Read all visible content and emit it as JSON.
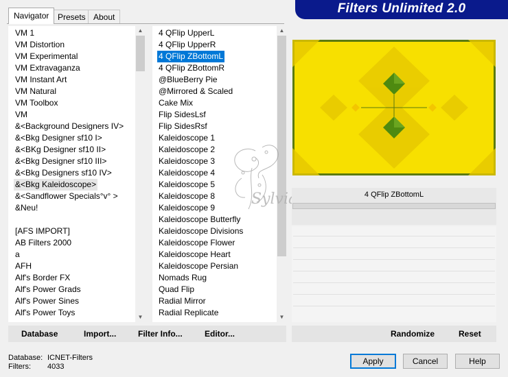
{
  "tabs": [
    {
      "label": "Navigator",
      "active": true
    },
    {
      "label": "Presets",
      "active": false
    },
    {
      "label": "About",
      "active": false
    }
  ],
  "banner": {
    "title": "Filters Unlimited 2.0"
  },
  "categories": {
    "items": [
      "VM 1",
      "VM Distortion",
      "VM Experimental",
      "VM Extravaganza",
      "VM Instant Art",
      "VM Natural",
      "VM Toolbox",
      "VM",
      "&<Background Designers IV>",
      "&<Bkg Designer sf10 I>",
      "&<BKg Designer sf10 II>",
      "&<Bkg Designer sf10 III>",
      "&<Bkg Designers sf10 IV>",
      "&<Bkg Kaleidoscope>",
      "&<Sandflower Specials°v° >",
      "&Neu!",
      "",
      "[AFS IMPORT]",
      "AB Filters 2000",
      "a",
      "AFH",
      "Alf's Border FX",
      "Alf's Power Grads",
      "Alf's Power Sines",
      "Alf's Power Toys"
    ],
    "highlighted_index": 13
  },
  "filters": {
    "items": [
      "4 QFlip UpperL",
      "4 QFlip UpperR",
      "4 QFlip ZBottomL",
      "4 QFlip ZBottomR",
      "@BlueBerry Pie",
      "@Mirrored & Scaled",
      "Cake Mix",
      "Flip SidesLsf",
      "Flip SidesRsf",
      "Kaleidoscope 1",
      "Kaleidoscope 2",
      "Kaleidoscope 3",
      "Kaleidoscope 4",
      "Kaleidoscope 5",
      "Kaleidoscope 8",
      "Kaleidoscope 9",
      "Kaleidoscope Butterfly",
      "Kaleidoscope Divisions",
      "Kaleidoscope Flower",
      "Kaleidoscope Heart",
      "Kaleidoscope Persian",
      "Nomads Rug",
      "Quad Flip",
      "Radial Mirror",
      "Radial Replicate"
    ],
    "selected_index": 2
  },
  "preview": {
    "filter_name": "4 QFlip ZBottomL",
    "colors": {
      "yellow": "#f7e000",
      "dark_yellow": "#c8b400",
      "green": "#3d7a10"
    }
  },
  "watermark": {
    "text": "Sylviane"
  },
  "left_buttons": {
    "database": "Database",
    "import": "Import...",
    "filter_info": "Filter Info...",
    "editor": "Editor..."
  },
  "right_buttons": {
    "randomize": "Randomize",
    "reset": "Reset"
  },
  "status": {
    "database_label": "Database:",
    "database_value": "ICNET-Filters",
    "filters_label": "Filters:",
    "filters_value": "4033"
  },
  "dialog_buttons": {
    "apply": "Apply",
    "cancel": "Cancel",
    "help": "Help"
  }
}
